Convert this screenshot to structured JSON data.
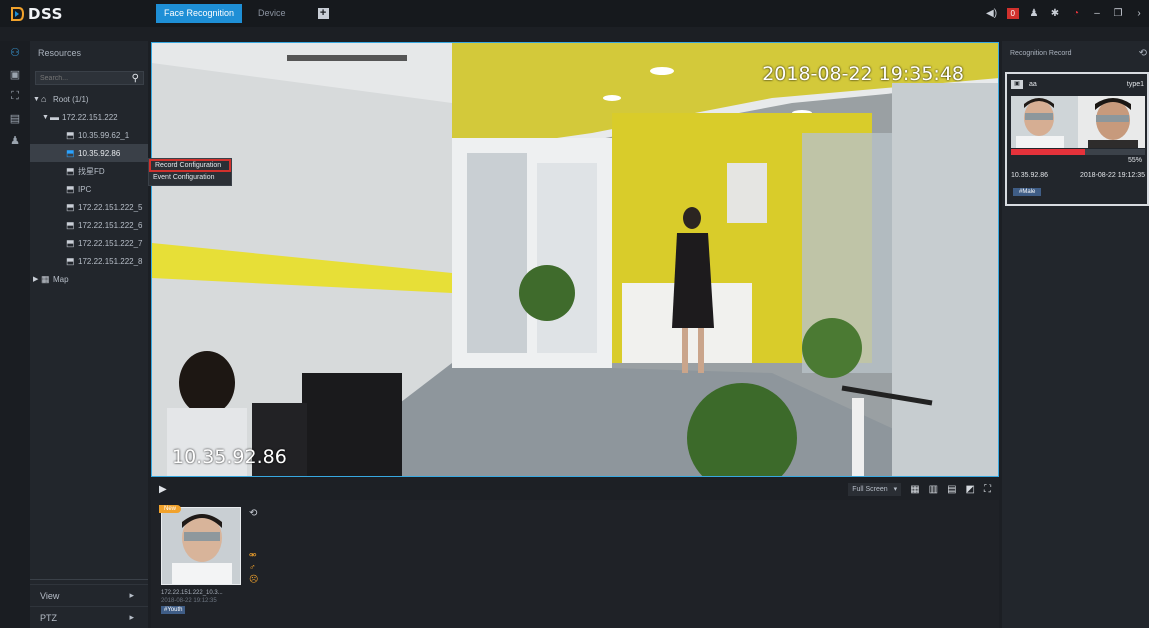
{
  "app": {
    "logo_text": "DSS",
    "accent": "#1e8fd6"
  },
  "tabs": [
    {
      "label": "Face Recognition",
      "active": true
    },
    {
      "label": "Device",
      "active": false
    }
  ],
  "topbar": {
    "alarm_count": "0"
  },
  "rail_icons": [
    "resources-icon",
    "face-search-icon",
    "face-db-icon",
    "report-icon",
    "user-icon"
  ],
  "resources": {
    "title": "Resources",
    "search_placeholder": "Search...",
    "tree": [
      {
        "label": "Root (1/1)",
        "level": 0,
        "icon": "root-icon"
      },
      {
        "label": "172.22.151.222",
        "level": 1,
        "icon": "nvr-icon"
      },
      {
        "label": "10.35.99.62_1",
        "level": 2,
        "icon": "camera-icon"
      },
      {
        "label": "10.35.92.86",
        "level": 2,
        "icon": "camera-icon",
        "selected": true
      },
      {
        "label": "找星FD",
        "level": 2,
        "icon": "camera-icon"
      },
      {
        "label": "IPC",
        "level": 2,
        "icon": "camera-icon"
      },
      {
        "label": "172.22.151.222_5",
        "level": 2,
        "icon": "camera-icon"
      },
      {
        "label": "172.22.151.222_6",
        "level": 2,
        "icon": "camera-icon"
      },
      {
        "label": "172.22.151.222_7",
        "level": 2,
        "icon": "camera-icon"
      },
      {
        "label": "172.22.151.222_8",
        "level": 2,
        "icon": "camera-icon"
      },
      {
        "label": "Map",
        "level": 0,
        "icon": "map-icon"
      }
    ],
    "bottom": {
      "view": "View",
      "ptz": "PTZ"
    }
  },
  "context_menu": {
    "items": [
      "Record Configuration",
      "Event Configuration"
    ]
  },
  "video": {
    "timestamp": "2018-08-22 19:35:48",
    "channel_name": "10.35.92.86"
  },
  "video_toolbar": {
    "fullscreen_label": "Full Screen"
  },
  "snapshot": {
    "badge": "New",
    "ip": "172.22.151.222_10.3...",
    "time": "2018-08-22 19:12:35",
    "tag": "#Youth"
  },
  "recognition": {
    "title": "Recognition Record",
    "name": "aa",
    "type": "type1",
    "similarity": "55%",
    "similarity_value": 0.55,
    "device": "10.35.92.86",
    "time": "2018-08-22 19:12:35",
    "tag": "#Male"
  }
}
